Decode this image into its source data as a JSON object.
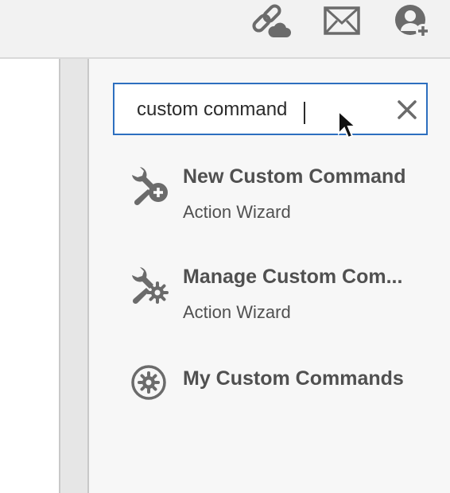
{
  "toolbar": {
    "icons": [
      "link-cloud-icon",
      "mail-icon",
      "add-user-icon"
    ]
  },
  "search": {
    "value": "custom command",
    "clear_icon": "close-icon"
  },
  "results": [
    {
      "title": "New Custom Command",
      "subtitle": "Action Wizard",
      "icon": "wrench-plus-icon"
    },
    {
      "title": "Manage Custom Com...",
      "subtitle": "Action Wizard",
      "icon": "wrench-gear-icon"
    },
    {
      "title": "My Custom Commands",
      "subtitle": "",
      "icon": "gear-circle-icon"
    }
  ],
  "colors": {
    "accent": "#2d6fbf",
    "icon": "#6b6b6b",
    "text": "#505050"
  }
}
